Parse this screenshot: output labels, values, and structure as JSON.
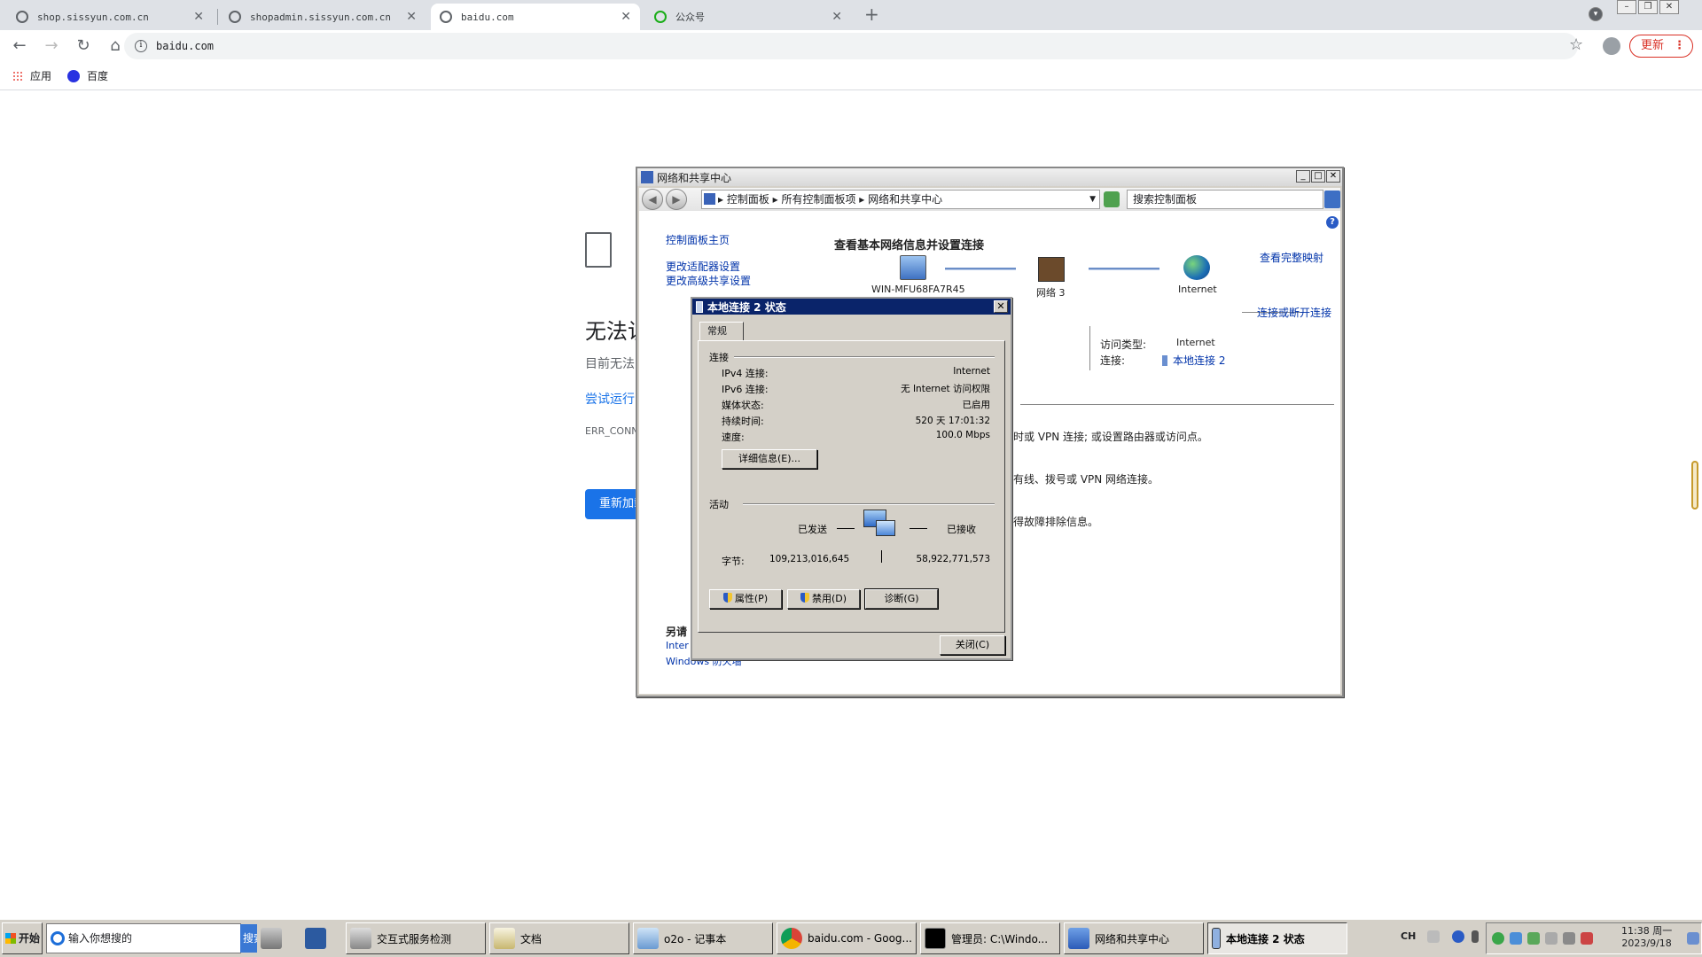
{
  "browser": {
    "tabs": [
      {
        "title": "shop.sissyun.com.cn",
        "active": false
      },
      {
        "title": "shopadmin.sissyun.com.cn",
        "active": false
      },
      {
        "title": "baidu.com",
        "active": true
      },
      {
        "title": "公众号",
        "active": false
      }
    ],
    "url": "baidu.com",
    "update_label": "更新",
    "bookmarks": [
      {
        "label": "应用",
        "icon": "apps-grid-icon"
      },
      {
        "label": "百度",
        "icon": "baidu-paw-icon"
      }
    ]
  },
  "error_page": {
    "title": "无法访",
    "subtitle": "目前无法",
    "link": "尝试运行",
    "code": "ERR_CONN",
    "reload_label": "重新加载"
  },
  "network_center": {
    "window_title": "网络和共享中心",
    "breadcrumb": "▸ 控制面板 ▸ 所有控制面板项 ▸ 网络和共享中心",
    "search_placeholder": "搜索控制面板",
    "sidebar": {
      "home": "控制面板主页",
      "adapter": "更改适配器设置",
      "advanced": "更改高级共享设置",
      "see_also": "另请",
      "inter": "Inter",
      "firewall": "Windows 防火墙"
    },
    "heading": "查看基本网络信息并设置连接",
    "full_map": "查看完整映射",
    "nodes": {
      "computer": "WIN-MFU68FA7R45",
      "network": "网络 3",
      "internet": "Internet"
    },
    "connect_disconnect": "连接或断开连接",
    "access_type_label": "访问类型:",
    "access_type_value": "Internet",
    "connection_label": "连接:",
    "connection_value": "本地连接 2",
    "task_lines": [
      "时或 VPN 连接; 或设置路由器或访问点。",
      "有线、拨号或 VPN 网络连接。",
      "得故障排除信息。"
    ]
  },
  "status_dialog": {
    "title": "本地连接 2 状态",
    "tab": "常规",
    "connection_section": "连接",
    "rows": [
      {
        "label": "IPv4 连接:",
        "value": "Internet"
      },
      {
        "label": "IPv6 连接:",
        "value": "无 Internet 访问权限"
      },
      {
        "label": "媒体状态:",
        "value": "已启用"
      },
      {
        "label": "持续时间:",
        "value": "520 天 17:01:32"
      },
      {
        "label": "速度:",
        "value": "100.0 Mbps"
      }
    ],
    "details_button": "详细信息(E)...",
    "activity_section": "活动",
    "sent_label": "已发送",
    "received_label": "已接收",
    "bytes_label": "字节:",
    "bytes_sent": "109,213,016,645",
    "bytes_received": "58,922,771,573",
    "properties_button": "属性(P)",
    "disable_button": "禁用(D)",
    "diagnose_button": "诊断(G)",
    "close_button": "关闭(C)"
  },
  "taskbar": {
    "start": "开始",
    "search_placeholder": "输入你想搜的",
    "search_button": "搜索一下",
    "items": [
      {
        "label": "交互式服务检测",
        "icon": "service-icon"
      },
      {
        "label": "文档",
        "icon": "document-icon"
      },
      {
        "label": "o2o - 记事本",
        "icon": "notepad-icon"
      },
      {
        "label": "baidu.com - Goog...",
        "icon": "chrome-icon"
      },
      {
        "label": "管理员: C:\\Windo...",
        "icon": "cmd-icon"
      },
      {
        "label": "网络和共享中心",
        "icon": "network-icon"
      },
      {
        "label": "本地连接 2 状态",
        "icon": "connection-icon"
      }
    ],
    "lang": "CH",
    "time": "11:38 周一",
    "date": "2023/9/18"
  }
}
